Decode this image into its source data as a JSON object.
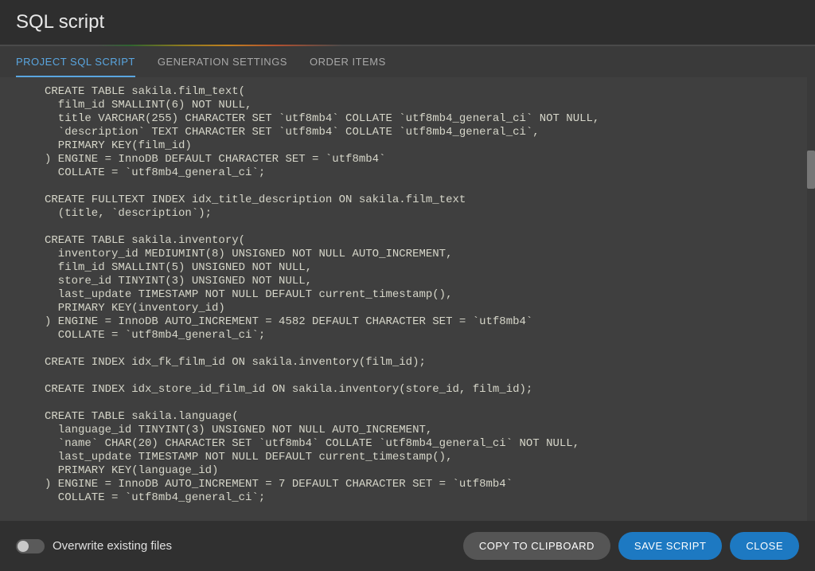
{
  "title": "SQL script",
  "tabs": [
    {
      "label": "PROJECT SQL SCRIPT",
      "active": true
    },
    {
      "label": "GENERATION SETTINGS",
      "active": false
    },
    {
      "label": "ORDER ITEMS",
      "active": false
    }
  ],
  "sql": "CREATE TABLE sakila.film_text(\n  film_id SMALLINT(6) NOT NULL,\n  title VARCHAR(255) CHARACTER SET `utf8mb4` COLLATE `utf8mb4_general_ci` NOT NULL,\n  `description` TEXT CHARACTER SET `utf8mb4` COLLATE `utf8mb4_general_ci`,\n  PRIMARY KEY(film_id)\n) ENGINE = InnoDB DEFAULT CHARACTER SET = `utf8mb4`\n  COLLATE = `utf8mb4_general_ci`;\n\nCREATE FULLTEXT INDEX idx_title_description ON sakila.film_text\n  (title, `description`);\n\nCREATE TABLE sakila.inventory(\n  inventory_id MEDIUMINT(8) UNSIGNED NOT NULL AUTO_INCREMENT,\n  film_id SMALLINT(5) UNSIGNED NOT NULL,\n  store_id TINYINT(3) UNSIGNED NOT NULL,\n  last_update TIMESTAMP NOT NULL DEFAULT current_timestamp(),\n  PRIMARY KEY(inventory_id)\n) ENGINE = InnoDB AUTO_INCREMENT = 4582 DEFAULT CHARACTER SET = `utf8mb4`\n  COLLATE = `utf8mb4_general_ci`;\n\nCREATE INDEX idx_fk_film_id ON sakila.inventory(film_id);\n\nCREATE INDEX idx_store_id_film_id ON sakila.inventory(store_id, film_id);\n\nCREATE TABLE sakila.language(\n  language_id TINYINT(3) UNSIGNED NOT NULL AUTO_INCREMENT,\n  `name` CHAR(20) CHARACTER SET `utf8mb4` COLLATE `utf8mb4_general_ci` NOT NULL,\n  last_update TIMESTAMP NOT NULL DEFAULT current_timestamp(),\n  PRIMARY KEY(language_id)\n) ENGINE = InnoDB AUTO_INCREMENT = 7 DEFAULT CHARACTER SET = `utf8mb4`\n  COLLATE = `utf8mb4_general_ci`;",
  "footer": {
    "overwrite_label": "Overwrite existing files",
    "copy_label": "COPY TO CLIPBOARD",
    "save_label": "SAVE SCRIPT",
    "close_label": "CLOSE"
  }
}
